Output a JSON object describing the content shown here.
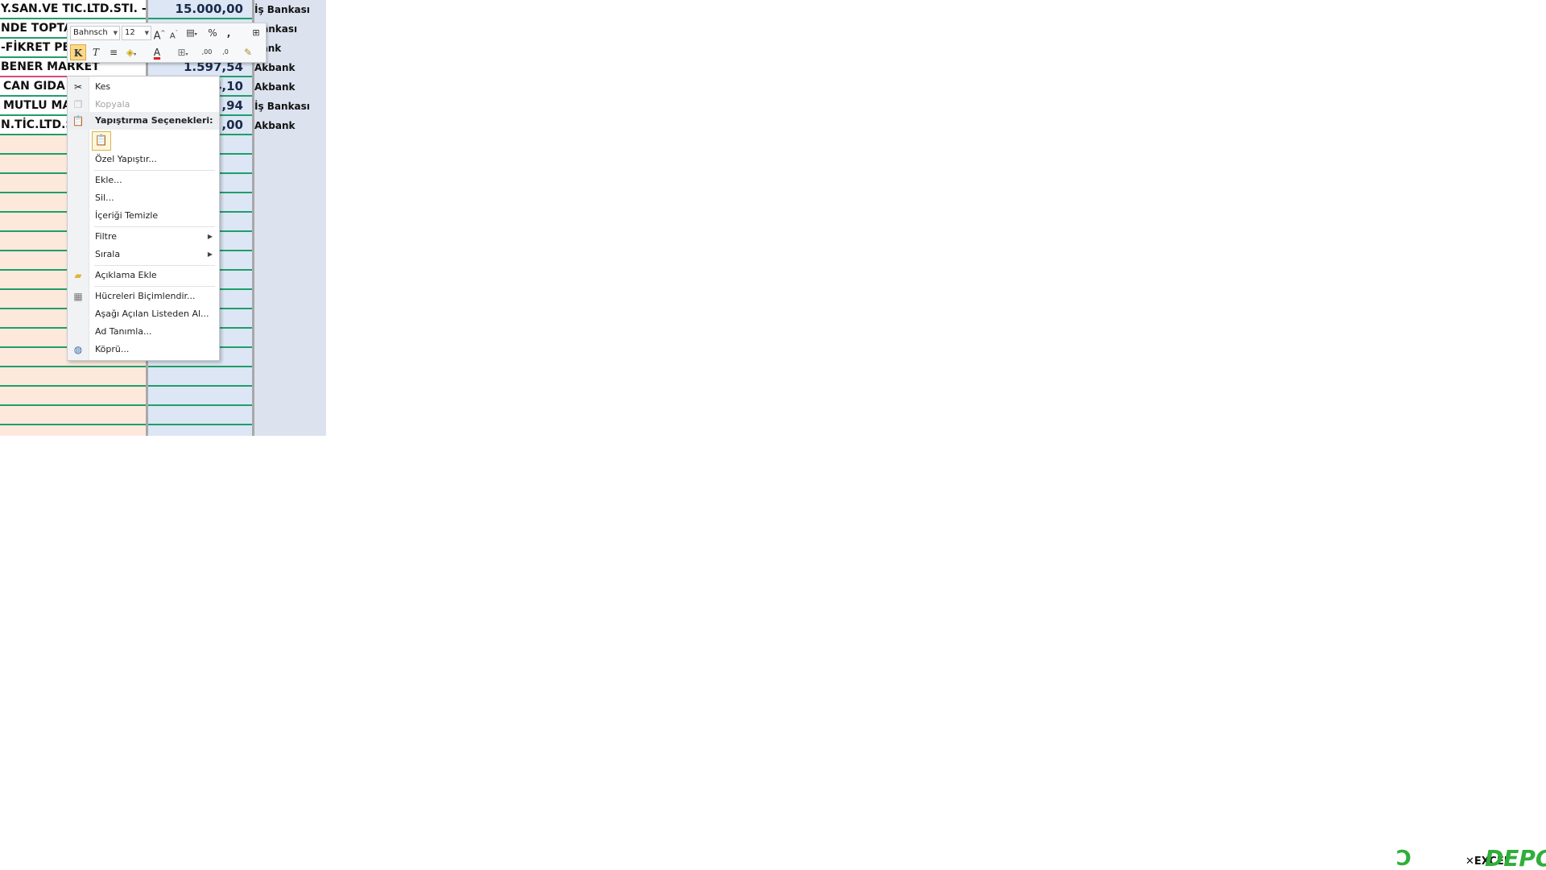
{
  "sheet": {
    "rows": [
      {
        "name": "Y.SAN.VE TIC.LTD.STI. - B",
        "amount": "15.000,00",
        "bank": "İş Bankası"
      },
      {
        "name": "NDE TOPTAN",
        "amount": "",
        "bank": "Bankası"
      },
      {
        "name": "-FİKRET PETRO",
        "amount": "",
        "bank": "bank"
      },
      {
        "name": "BENER MARKET",
        "amount": "1.597,54",
        "bank": "Akbank"
      },
      {
        "name": "CAN GIDA",
        "amount": "4,10",
        "bank": "Akbank"
      },
      {
        "name": "MUTLU MAR",
        "amount": ",94",
        "bank": "İş Bankası"
      },
      {
        "name": "N.TİC.LTD.ŞT",
        "amount": ",00",
        "bank": "Akbank"
      }
    ]
  },
  "mini_toolbar": {
    "font_name": "Bahnsch",
    "font_size": "12",
    "grow_font": "A",
    "shrink_font": "A",
    "percent": "%",
    "comma": ",",
    "bold": "K",
    "italic": "T",
    "font_color": "A",
    "inc_decimal": ",00",
    "dec_decimal": ",0"
  },
  "context_menu": {
    "items": {
      "cut": "Kes",
      "copy": "Kopyala",
      "paste_options": "Yapıştırma Seçenekleri:",
      "paste_special": "Özel Yapıştır...",
      "insert": "Ekle...",
      "delete": "Sil...",
      "clear_contents": "İçeriği Temizle",
      "filter": "Filtre",
      "sort": "Sırala",
      "add_comment": "Açıklama Ekle",
      "format_cells": "Hücreleri Biçimlendir...",
      "pick_from_list": "Aşağı Açılan Listeden Al...",
      "define_name": "Ad Tanımla...",
      "hyperlink": "Köprü..."
    }
  },
  "watermark": {
    "text": "EXCEL",
    "brand": "DEPO"
  }
}
